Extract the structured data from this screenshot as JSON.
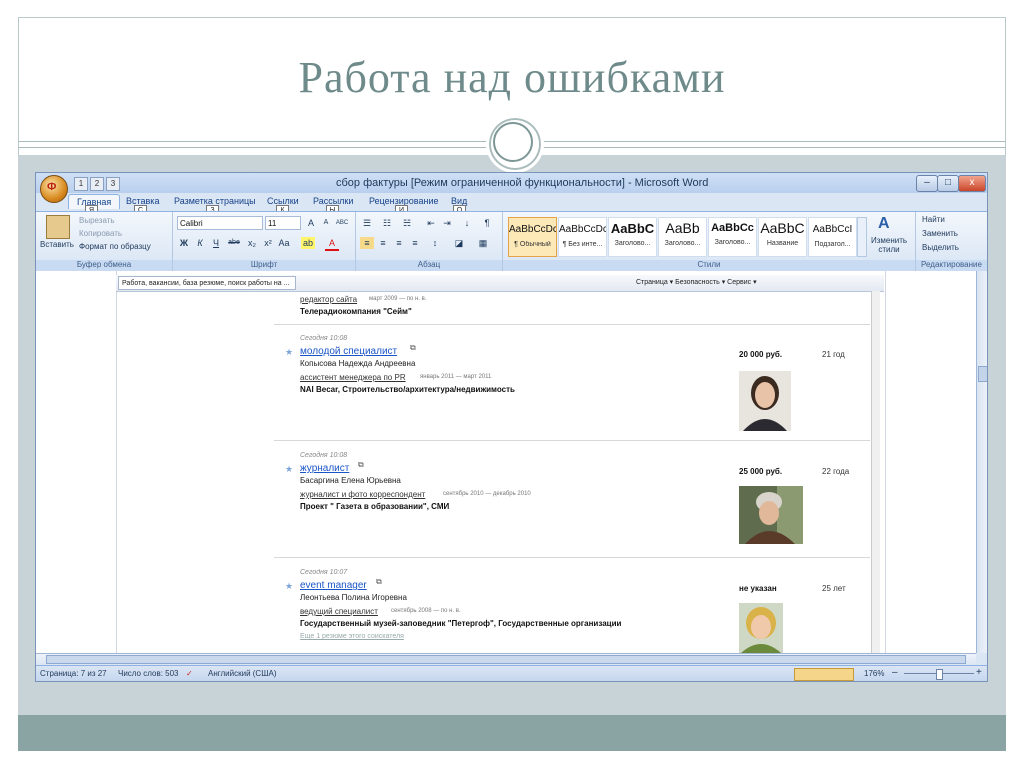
{
  "slide": {
    "title": "Работа над ошибками",
    "colors": {
      "title": "#6f8a8a",
      "band": "#c7d3d7",
      "footer": "#8aa3a3"
    }
  },
  "window": {
    "title": "сбор фактуры [Режим ограниченной функциональности] - Microsoft Word",
    "office_keytip": "Ф",
    "qat_keytips": [
      "1",
      "2",
      "3"
    ],
    "buttons": {
      "minimize": "–",
      "maximize": "□",
      "close": "x"
    }
  },
  "ribbon": {
    "tabs": [
      {
        "label": "Главная",
        "keytip": "Я"
      },
      {
        "label": "Вставка",
        "keytip": "С"
      },
      {
        "label": "Разметка страницы",
        "keytip": "З"
      },
      {
        "label": "Ссылки",
        "keytip": "К"
      },
      {
        "label": "Рассылки",
        "keytip": "Ы"
      },
      {
        "label": "Рецензирование",
        "keytip": "И"
      },
      {
        "label": "Вид",
        "keytip": "О"
      }
    ],
    "clipboard": {
      "paste": "Вставить",
      "cut": "Вырезать",
      "copy": "Копировать",
      "format_painter": "Формат по образцу",
      "label": "Буфер обмена"
    },
    "font": {
      "name": "Calibri",
      "size": "11",
      "grow": "A",
      "shrink": "A",
      "clear": "ABC",
      "bold": "Ж",
      "italic": "К",
      "underline": "Ч",
      "strike": "abe",
      "subscript": "x₂",
      "superscript": "x²",
      "case": "Aa",
      "highlight": "ab",
      "color": "A",
      "label": "Шрифт"
    },
    "paragraph": {
      "bullets": "☰",
      "numbering": "☷",
      "multilevel": "☵",
      "decrease_indent": "⇤",
      "increase_indent": "⇥",
      "sort": "↓",
      "show_marks": "¶",
      "align_left": "≡",
      "align_center": "≡",
      "align_right": "≡",
      "justify": "≡",
      "line_spacing": "↕",
      "shading": "◪",
      "borders": "▦",
      "label": "Абзац"
    },
    "styles": {
      "items": [
        {
          "preview": "AaBbCcDc",
          "name": "¶ Обычный"
        },
        {
          "preview": "AaBbCcDc",
          "name": "¶ Без инте..."
        },
        {
          "preview": "AaBbC",
          "name": "Заголово..."
        },
        {
          "preview": "AaBb",
          "name": "Заголово..."
        },
        {
          "preview": "AaBbCc",
          "name": "Заголово..."
        },
        {
          "preview": "AaBbC",
          "name": "Название"
        },
        {
          "preview": "AaBbCcI",
          "name": "Подзагол..."
        }
      ],
      "change": "Изменить стили",
      "change_icon": "A",
      "label": "Стили"
    },
    "editing": {
      "find": "Найти",
      "replace": "Заменить",
      "select": "Выделить",
      "label": "Редактирование"
    }
  },
  "browser": {
    "tab": "Работа, вакансии, база резюме, поиск работы на ...",
    "tools": "Страница ▾   Безопасность ▾   Сервис ▾"
  },
  "entries": {
    "top": {
      "position": "редактор сайта",
      "dates": "март 2009 — по н. в.",
      "org": "Телерадиокомпания \"Сейм\""
    },
    "list": [
      {
        "when": "Сегодня 10:08",
        "title": "молодой специалист",
        "name": "Копысова Надежда Андреевна",
        "position": "ассистент менеджера по PR",
        "dates": "январь 2011 — март 2011",
        "org": "NAI Becar, Строительство/архитектура/недвижимость",
        "salary": "20 000 руб.",
        "age": "21 год",
        "extra": ""
      },
      {
        "when": "Сегодня 10:08",
        "title": "журналист",
        "name": "Басаргина Елена Юрьевна",
        "position": "журналист и фото корреспондент",
        "dates": "сентябрь 2010 — декабрь 2010",
        "org": "Проект \" Газета в образовании\", СМИ",
        "salary": "25 000 руб.",
        "age": "22 года",
        "extra": ""
      },
      {
        "when": "Сегодня 10:07",
        "title": "event manager",
        "name": "Леонтьева Полина Игоревна",
        "position": "ведущий специалист",
        "dates": "сентябрь 2008 — по н. в.",
        "org": "Государственный музей-заповедник \"Петергоф\", Государственные организации",
        "salary": "не указан",
        "age": "25 лет",
        "extra": "Еще 1 резюме этого соискателя"
      }
    ]
  },
  "status": {
    "page": "Страница: 7 из 27",
    "words": "Число слов: 503",
    "language": "Английский (США)",
    "zoom": "176%",
    "zoom_out": "–",
    "zoom_in": "+"
  }
}
